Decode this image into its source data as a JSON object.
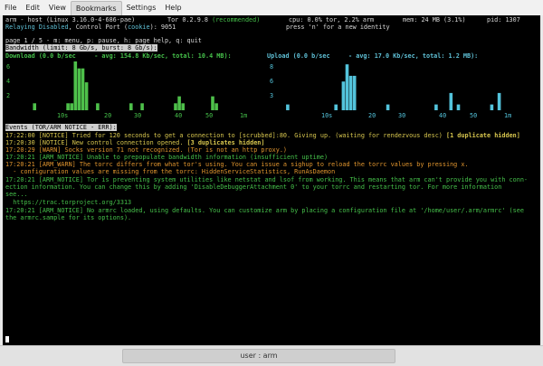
{
  "menubar": {
    "items": [
      "File",
      "Edit",
      "View",
      "Bookmarks",
      "Settings",
      "Help"
    ],
    "active": "Bookmarks"
  },
  "header": {
    "line1_left": "arm - host (Linux 3.16.0-4-686-pae)",
    "tor_version": "Tor 0.2.9.8",
    "tor_status": "(recommended)",
    "cpu": "cpu: 0.0% tor, 2.2% arm",
    "mem": "mem: 24 MB (3.1%)",
    "pid": "pid: 1307",
    "relaying": "Relaying Disabled",
    "control_prefix": ", Control Port (",
    "cookie": "cookie",
    "control_suffix": "): 9051",
    "newnym_hint": "press 'n' for a new identity"
  },
  "page_line": "page 1 / 5 - m: menu, p: pause, h: page help, q: quit",
  "bandwidth": {
    "title": "Bandwidth (limit: 8 Gb/s, burst: 8 Gb/s):",
    "download_label": "Download (0.0 b/sec",
    "download_stats": "- avg: 154.8 Kb/sec, total: 10.4 MB):",
    "upload_label": "Upload (0.0 b/sec",
    "upload_stats": "- avg: 17.0 Kb/sec, total: 1.2 MB):",
    "download_y_ticks": [
      "6",
      "4",
      "2"
    ],
    "upload_y_ticks": [
      "8",
      "6",
      "3"
    ],
    "x_ticks": [
      "10s",
      "20",
      "30",
      "40",
      "50",
      "1m"
    ]
  },
  "chart_data": [
    {
      "type": "bar",
      "title": "Download (0.0 b/sec - avg: 154.8 Kb/sec, total: 10.4 MB)",
      "x_ticks": [
        "10s",
        "20",
        "30",
        "40",
        "50",
        "1m"
      ],
      "y_ticks": [
        6,
        4,
        2
      ],
      "ylim": [
        0,
        7
      ],
      "values": [
        0,
        0,
        0,
        0,
        1,
        0,
        0,
        0,
        0,
        0,
        0,
        0,
        0,
        1,
        1,
        7,
        6,
        6,
        4,
        0,
        0,
        1,
        0,
        0,
        0,
        0,
        0,
        0,
        0,
        0,
        1,
        0,
        0,
        1,
        0,
        0,
        0,
        0,
        0,
        0,
        0,
        0,
        1,
        2,
        1,
        0,
        0,
        0,
        0,
        0,
        0,
        0,
        2,
        1,
        0,
        0,
        0,
        0,
        0,
        0
      ],
      "color": "#4ec04a"
    },
    {
      "type": "bar",
      "title": "Upload (0.0 b/sec - avg: 17.0 Kb/sec, total: 1.2 MB)",
      "x_ticks": [
        "10s",
        "20",
        "30",
        "40",
        "50",
        "1m"
      ],
      "y_ticks": [
        8,
        6,
        3
      ],
      "ylim": [
        0,
        8.5
      ],
      "values": [
        0,
        1,
        0,
        0,
        0,
        0,
        0,
        0,
        0,
        0,
        0,
        0,
        0,
        0,
        1,
        0,
        5,
        8,
        6,
        6,
        0,
        0,
        0,
        0,
        0,
        0,
        0,
        0,
        1,
        0,
        0,
        0,
        0,
        0,
        0,
        0,
        0,
        0,
        0,
        0,
        0,
        1,
        0,
        0,
        0,
        3,
        0,
        1,
        0,
        0,
        0,
        0,
        0,
        0,
        0,
        0,
        1,
        0,
        3,
        0
      ],
      "color": "#53c3db"
    }
  ],
  "events": {
    "title": "Events (TOR/ARM NOTICE - ERR):",
    "entries": [
      {
        "time": "17:22:00",
        "tag": "[NOTICE]",
        "text": "Tried for 120 seconds to get a connection to [scrubbed]:80. Giving up. (waiting for rendezvous desc)",
        "extra": "[1 duplicate hidden]",
        "color": "#d7c64e"
      },
      {
        "time": "17:20:30",
        "tag": "[NOTICE]",
        "text": "New control connection opened.",
        "extra": "[3 duplicates hidden]",
        "color": "#d7c64e"
      },
      {
        "time": "17:20:29",
        "tag": "[WARN]",
        "text": "Socks version 71 not recognized. (Tor is not an http proxy.)",
        "extra": "",
        "color": "#e0952e"
      },
      {
        "time": "17:20:21",
        "tag": "[ARM_NOTICE]",
        "text": "Unable to prepopulate bandwidth information (insufficient uptime)",
        "extra": "",
        "color": "#45c04a"
      },
      {
        "time": "17:20:21",
        "tag": "[ARM_WARN]",
        "text": "The torrc differs from what tor's using. You can issue a sighup to reload the torrc values by pressing x.\n  - configuration values are missing from the torrc: HiddenServiceStatistics, RunAsDaemon",
        "extra": "",
        "color": "#e0952e"
      },
      {
        "time": "17:20:21",
        "tag": "[ARM_NOTICE]",
        "text": "Tor is preventing system utilities like netstat and lsof from working. This means that arm can't provide you with conn-\nection information. You can change this by adding 'DisableDebuggerAttachment 0' to your torrc and restarting tor. For more information\nsee...\n  https://trac.torproject.org/3313",
        "extra": "",
        "color": "#45c04a"
      },
      {
        "time": "17:20:21",
        "tag": "[ARM_NOTICE]",
        "text": "No armrc loaded, using defaults. You can customize arm by placing a configuration file at '/home/user/.arm/armrc' (see\nthe armrc.sample for its options).",
        "extra": "",
        "color": "#45c04a"
      }
    ]
  },
  "statusbar": {
    "user": "user : arm"
  }
}
